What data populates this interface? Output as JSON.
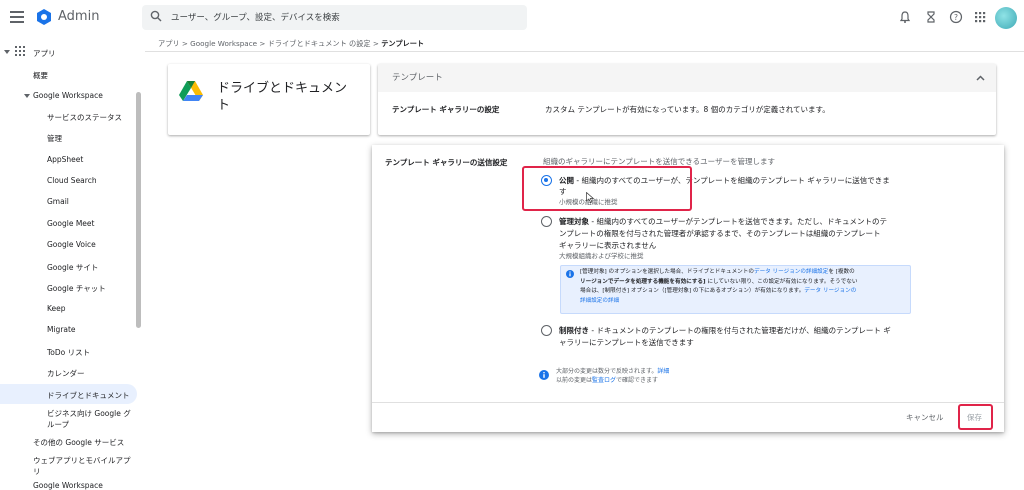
{
  "app": {
    "name": "Admin"
  },
  "search": {
    "placeholder": "ユーザー、グループ、設定、デバイスを検索"
  },
  "breadcrumb": {
    "items": [
      "アプリ",
      "Google Workspace",
      "ドライブとドキュメント の設定",
      "テンプレート"
    ]
  },
  "sidebar": {
    "root": "アプリ",
    "items": [
      "概要",
      "Google Workspace",
      "サービスのステータス",
      "管理",
      "AppSheet",
      "Cloud Search",
      "Gmail",
      "Google Meet",
      "Google Voice",
      "Google サイト",
      "Google チャット",
      "Keep",
      "Migrate",
      "ToDo リスト",
      "カレンダー",
      "ドライブとドキュメント",
      "ビジネス向け Google グ",
      "ループ",
      "その他の Google サービス",
      "ウェブアプリとモバイルアプ",
      "リ",
      "Google Workspace"
    ]
  },
  "service_card": {
    "title": "ドライブとドキュメント"
  },
  "panel": {
    "header": "テンプレート",
    "gallery_label": "テンプレート ギャラリーの設定",
    "gallery_value": "カスタム テンプレートが有効になっています。8 個のカテゴリが定義されています。"
  },
  "dialog": {
    "label": "テンプレート ギャラリーの送信設定",
    "description": "組織のギャラリーにテンプレートを送信できるユーザーを管理します",
    "options": [
      {
        "bold": "公開",
        "line1": " - 組織内のすべてのユーザーが、テンプレートを組織のテンプレート ギャラリーに送信できま",
        "line2": "す",
        "hint": "小規模の組織に推奨",
        "selected": true
      },
      {
        "bold": "管理対象",
        "line1": " - 組織内のすべてのユーザーがテンプレートを送信できます。ただし、ドキュメントのテ",
        "line2": "ンプレートの権限を付与された管理者が承認するまで、そのテンプレートは組織のテンプレート",
        "line3": "ギャラリーに表示されません",
        "hint": "大規模組織および学校に推奨",
        "selected": false
      },
      {
        "bold": "制限付き",
        "line1": " - ドキュメントのテンプレートの権限を付与された管理者だけが、組織のテンプレート ギ",
        "line2": "ャラリーにテンプレートを送信できます",
        "selected": false
      }
    ],
    "info": {
      "l1a": "[管理対象] のオプションを選択した場合、ドライブとドキュメントの",
      "l1link": "データ リージョンの詳細設定",
      "l1b": "を [複数の",
      "l2a": "リージョンでデータを処理する機能を有効にする]",
      "l2b": " にしていない限り、この設定が有効になります。そうでない",
      "l3a": "場合は、[制限付き] オプション（[管理対象] の下にあるオプション）が有効になります。",
      "l3link": "データ リージョンの",
      "l4link": "詳細設定の詳細"
    },
    "notice": {
      "l1": "大部分の変更は数分で反映されます。",
      "l1link": "詳細",
      "l2a": "以前の変更は",
      "l2link": "監査ログ",
      "l2b": "で確認できます"
    },
    "cancel": "キャンセル",
    "save": "保存"
  },
  "colors": {
    "accent": "#1a73e8",
    "highlight": "#e02449"
  }
}
